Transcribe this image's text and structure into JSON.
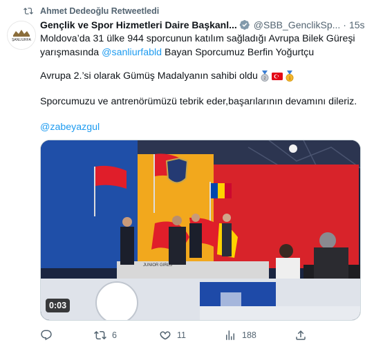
{
  "retweet": {
    "text": "Ahmet Dedeoğlu Retweetledi"
  },
  "author": {
    "name": "Gençlik ve Spor Hizmetleri Daire Başkanl...",
    "handle": "@SBB_GenclikSp...",
    "separator": "·",
    "time": "15s",
    "avatar_text": "ŞANLIURFA"
  },
  "tweet": {
    "line1": "Moldova’da 31 ülke 944 sporcunun katılım sağladığı Avrupa Bilek Güreşi",
    "line2_pre": "yarışmasında ",
    "mention": "@sanliurfabld",
    "line2_post": " Bayan Sporcumuz Berfin Yoğurtçu",
    "para2": "Avrupa 2.’si olarak Gümüş Madalyanın sahibi oldu",
    "para3": "Sporcumuzu ve antrenörümüzü tebrik eder,başarılarının devamını dileriz.",
    "para4": "@zabeyazgul"
  },
  "media": {
    "duration": "0:03"
  },
  "actions": {
    "reply": "",
    "retweets": "6",
    "likes": "11",
    "views": "188"
  },
  "colors": {
    "link": "#1d9bf0",
    "muted": "#536471",
    "text": "#0f1419"
  }
}
